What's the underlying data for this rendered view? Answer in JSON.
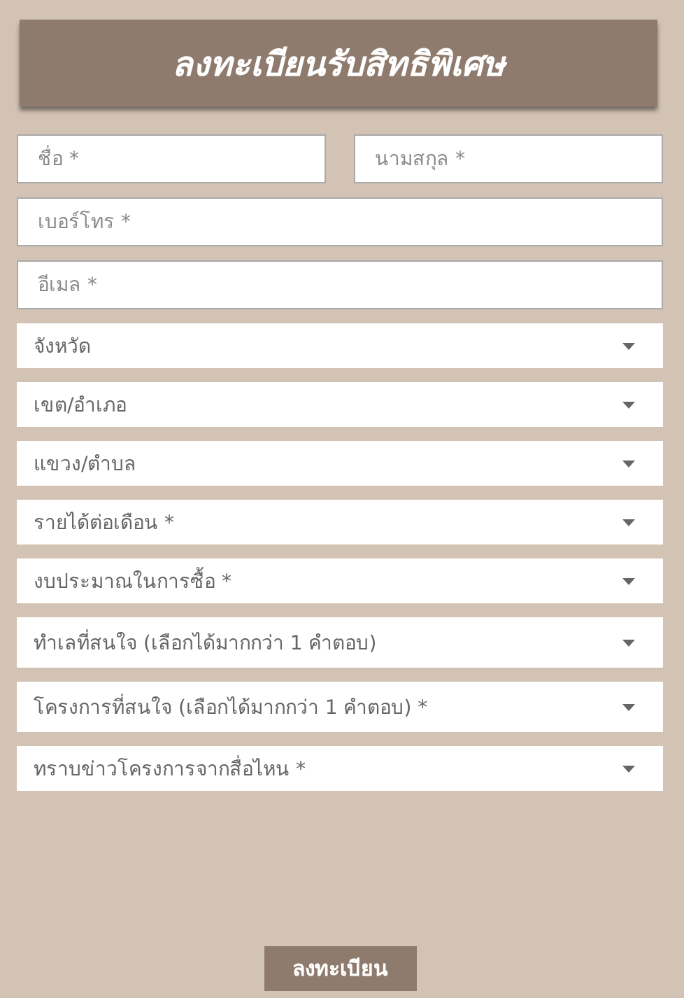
{
  "title": "ลงทะเบียนรับสิทธิพิเศษ",
  "name_fields": [
    {
      "placeholder": "ชื่อ *"
    },
    {
      "placeholder": "นามสกุล *"
    }
  ],
  "fields": [
    {
      "placeholder": "เบอร์โทร *"
    },
    {
      "placeholder": "อีเมล *"
    }
  ],
  "dropdowns": [
    {
      "label": "จังหวัด",
      "kind": "single"
    },
    {
      "label": "เขต/อำเภอ",
      "kind": "single"
    },
    {
      "label": "แขวง/ตำบล",
      "kind": "single"
    },
    {
      "label": "รายได้ต่อเดือน *",
      "kind": "single"
    },
    {
      "label": "งบประมาณในการซื้อ *",
      "kind": "single"
    },
    {
      "label": "ทำเลที่สนใจ (เลือกได้มากกว่า 1 คำตอบ)",
      "kind": "multi"
    },
    {
      "label": "โครงการที่สนใจ (เลือกได้มากกว่า 1 คำตอบ) *",
      "kind": "multi"
    },
    {
      "label": "ทราบข่าวโครงการจากสื่อไหน *",
      "kind": "single"
    }
  ],
  "submit": "ลงทะเบียน"
}
